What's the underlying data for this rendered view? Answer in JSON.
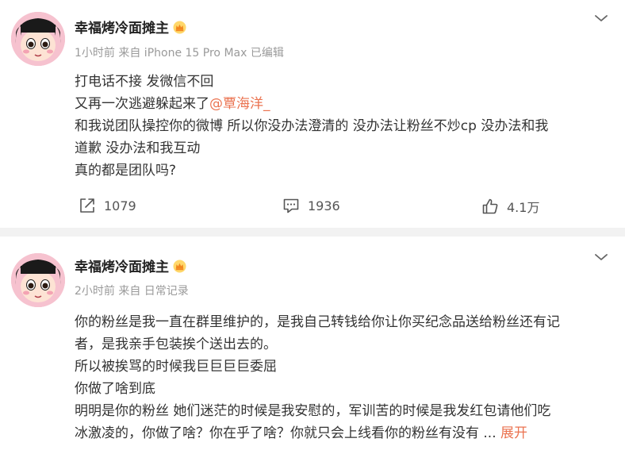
{
  "posts": [
    {
      "username": "幸福烤冷面摊主",
      "meta": "1小时前 来自 iPhone 15 Pro Max 已编辑",
      "lines": {
        "l1": "打电话不接 发微信不回",
        "l2_text": "又再一次逃避躲起来了",
        "l2_mention": "@覃海洋_",
        "l3": "和我说团队操控你的微博  所以你没办法澄清的 没办法让粉丝不炒cp  没办法和我",
        "l4": "道歉 没办法和我互动",
        "l5": "真的都是团队吗?"
      },
      "actions": {
        "repost": "1079",
        "comment": "1936",
        "like": "4.1万"
      }
    },
    {
      "username": "幸福烤冷面摊主",
      "meta": "2小时前 来自 日常记录",
      "lines": {
        "l1": "你的粉丝是我一直在群里维护的，是我自己转钱给你让你买纪念品送给粉丝还有记",
        "l2": "者，是我亲手包装挨个送出去的。",
        "l3": "所以被挨骂的时候我巨巨巨巨委屈",
        "l4": "你做了啥到底",
        "l5": "明明是你的粉丝 她们迷茫的时候是我安慰的，军训苦的时候是我发红包请他们吃",
        "l6_text": "冰激凌的，你做了啥？你在乎了啥？你就只会上线看你的粉丝有没有 ...",
        "l6_expand": "展开"
      }
    }
  ],
  "colors": {
    "accent": "#eb7350",
    "meta": "#9a9a9a",
    "separator": "#f2f2f2"
  },
  "icons": [
    "avatar",
    "crown-icon",
    "chevron-down-icon",
    "repost-icon",
    "comment-icon",
    "like-icon"
  ]
}
